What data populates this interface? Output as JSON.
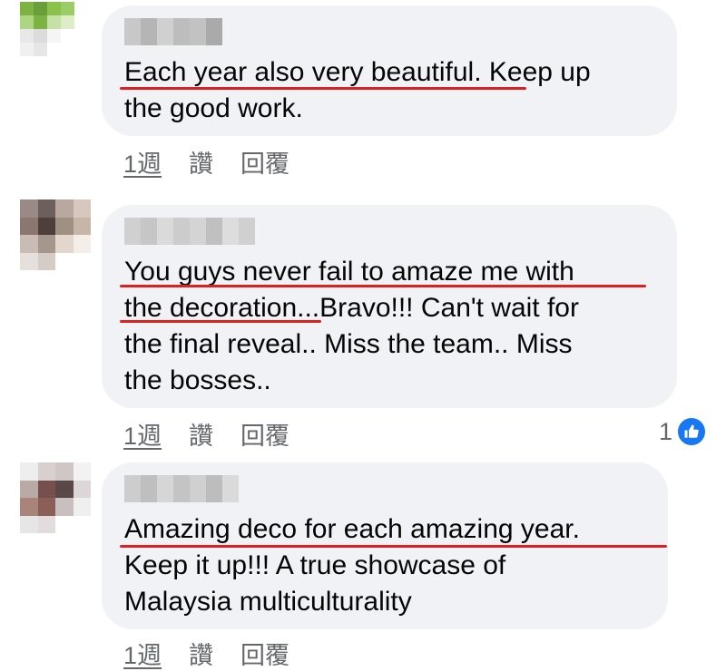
{
  "comments": [
    {
      "text": "Each year also very beautiful. Keep up\nthe good work.",
      "time": "1週",
      "like_label": "讚",
      "reply_label": "回覆"
    },
    {
      "text": "You guys never fail to amaze me with\nthe decoration...Bravo!!! Can't wait for\nthe final reveal.. Miss the team.. Miss\nthe bosses..",
      "time": "1週",
      "like_label": "讚",
      "reply_label": "回覆",
      "reaction_count": "1",
      "reaction_icon": "thumbs-up-icon"
    },
    {
      "text": "Amazing deco for each amazing year.\nKeep it up!!! A true showcase of\nMalaysia multiculturality",
      "time": "1週",
      "like_label": "讚",
      "reply_label": "回覆"
    }
  ],
  "colors": {
    "bubble": "#f0f2f5",
    "highlight": "#e02020",
    "meta_text": "#65676b",
    "like_blue": "#1877f2"
  }
}
